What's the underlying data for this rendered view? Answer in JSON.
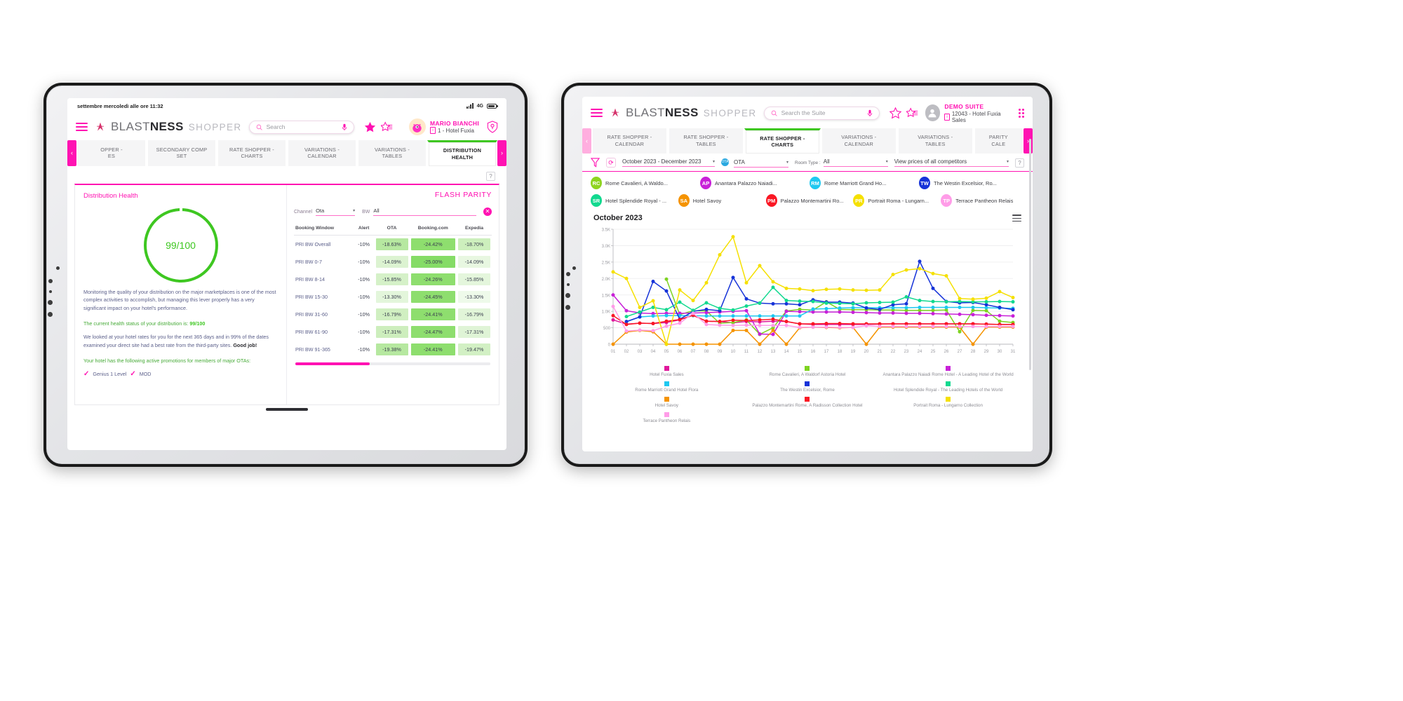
{
  "colors": {
    "pink": "#ff12b2",
    "green": "#3ec721",
    "text": "#3c3c42"
  },
  "left_tablet": {
    "statusbar": {
      "date": "settembre mercoledì alle ore 11:32",
      "network": "4G"
    },
    "appbar": {
      "menu_icon": "hamburger-icon",
      "brand_a": "BLAST",
      "brand_b": "NESS",
      "sub_brand": "SHOPPER",
      "search_placeholder": "Search",
      "mic_icon": "microphone-icon",
      "star_filled_icon": "star-filled-icon",
      "star_list_icon": "star-list-icon",
      "user_name": "MARIO BIANCHI",
      "user_hotel": "1 - Hotel Fuxia",
      "shield_icon": "shield-key-icon"
    },
    "tabs": [
      {
        "label": "OPPER -\nES",
        "active": false
      },
      {
        "label": "SECONDARY COMP\nSET",
        "active": false
      },
      {
        "label": "RATE SHOPPER -\nCHARTS",
        "active": false
      },
      {
        "label": "VARIATIONS -\nCALENDAR",
        "active": false
      },
      {
        "label": "VARIATIONS -\nTABLES",
        "active": false
      },
      {
        "label": "DISTRIBUTION\nHEALTH",
        "active": true
      }
    ],
    "help_label": "?",
    "distribution": {
      "title": "Distribution Health",
      "score": "99/100",
      "paragraph_1": "Monitoring the quality of your distribution on the major marketplaces is one of the most complex activities to accomplish, but managing this lever properly has a very significant impact on your hotel's performance.",
      "status_prefix": "The current health status of your distribution is:",
      "status_value": "99/100",
      "paragraph_2_a": "We looked at your hotel rates for you for the next 365 days and in 99% of the dates examined your direct site had a best rate from the third-party sites.",
      "paragraph_2_b": "Good job!",
      "promotions_intro": "Your hotel has the following active promotions for members of major OTAs:",
      "promotions": [
        "Genius 1 Level",
        "MOD"
      ]
    },
    "flash_parity": {
      "title": "FLASH PARITY",
      "channel_label": "Channel",
      "channel_value": "Ota",
      "bw_label": "BW",
      "bw_value": "All",
      "clear_icon": "clear-circle-icon",
      "columns": [
        "Booking Window",
        "Alert",
        "OTA",
        "Booking.com",
        "Expedia"
      ],
      "rows": [
        {
          "window": "PRI BW Overall",
          "alert": "-10%",
          "ota": "-18.63%",
          "booking": "-24.42%",
          "expedia": "-18.70%",
          "ota_bg": "#b6e8a0",
          "booking_bg": "#8ede6e",
          "expedia_bg": "#cdefbd"
        },
        {
          "window": "PRI BW 0-7",
          "alert": "-10%",
          "ota": "-14.09%",
          "booking": "-25.00%",
          "expedia": "-14.09%",
          "ota_bg": "#dcf3d1",
          "booking_bg": "#85dc66",
          "expedia_bg": "#e8f7e1"
        },
        {
          "window": "PRI BW 8-14",
          "alert": "-10%",
          "ota": "-15.85%",
          "booking": "-24.26%",
          "expedia": "-15.85%",
          "ota_bg": "#d5f1c8",
          "booking_bg": "#8ede6e",
          "expedia_bg": "#e4f6dc"
        },
        {
          "window": "PRI BW 15-30",
          "alert": "-10%",
          "ota": "-13.30%",
          "booking": "-24.45%",
          "expedia": "-13.30%",
          "ota_bg": "#e3f6db",
          "booking_bg": "#8ede6e",
          "expedia_bg": "#eefaea"
        },
        {
          "window": "PRI BW 31-60",
          "alert": "-10%",
          "ota": "-16.79%",
          "booking": "-24.41%",
          "expedia": "-16.79%",
          "ota_bg": "#d0efc1",
          "booking_bg": "#8ede6e",
          "expedia_bg": "#e1f5d8"
        },
        {
          "window": "PRI BW 61-90",
          "alert": "-10%",
          "ota": "-17.31%",
          "booking": "-24.47%",
          "expedia": "-17.31%",
          "ota_bg": "#cdeebd",
          "booking_bg": "#8ede6e",
          "expedia_bg": "#dff4d6"
        },
        {
          "window": "PRI BW 91-365",
          "alert": "-10%",
          "ota": "-19.38%",
          "booking": "-24.41%",
          "expedia": "-19.47%",
          "ota_bg": "#b6e8a0",
          "booking_bg": "#8ede6e",
          "expedia_bg": "#d2f0c4"
        }
      ]
    }
  },
  "right_tablet": {
    "appbar": {
      "menu_icon": "hamburger-icon",
      "brand_a": "BLAST",
      "brand_b": "NESS",
      "sub_brand": "SHOPPER",
      "search_placeholder": "Search the Suite",
      "mic_icon": "microphone-icon",
      "star_outline_icon": "star-outline-icon",
      "star_list_icon": "star-list-icon",
      "user_name": "DEMO SUITE",
      "user_hotel": "12043 - Hotel Fuxia Sales",
      "grid_icon": "grid-apps-icon"
    },
    "tabs": [
      {
        "label": "RATE SHOPPER -\nCALENDAR",
        "active": false
      },
      {
        "label": "RATE SHOPPER -\nTABLES",
        "active": false
      },
      {
        "label": "RATE SHOPPER -\nCHARTS",
        "active": true
      },
      {
        "label": "VARIATIONS -\nCALENDAR",
        "active": false
      },
      {
        "label": "VARIATIONS -\nTABLES",
        "active": false
      },
      {
        "label": "PARITY\nCALE",
        "active": false
      }
    ],
    "filters": {
      "filter_icon": "funnel-icon",
      "refresh_icon": "refresh-icon",
      "date_range": "October 2023 - December 2023",
      "channel_icon": "ota-badge-icon",
      "channel": "OTA",
      "room_type_label": "Room Type :",
      "room_type": "All",
      "competitor_view": "View prices of all competitors",
      "help_label": "?"
    },
    "competitor_chips": [
      {
        "initials": "RC",
        "name": "Rome Cavalieri, A Waldo...",
        "color": "#8ed420"
      },
      {
        "initials": "AP",
        "name": "Anantara Palazzo Naiadi...",
        "color": "#c821d8"
      },
      {
        "initials": "RM",
        "name": "Rome Marriott Grand Ho...",
        "color": "#1ec8f0"
      },
      {
        "initials": "TW",
        "name": "The Westin Excelsior, Ro...",
        "color": "#1633d8"
      },
      {
        "initials": "SR",
        "name": "Hotel Splendide Royal - ...",
        "color": "#12d98f"
      },
      {
        "initials": "SA",
        "name": "Hotel Savoy",
        "color": "#f59300"
      },
      {
        "initials": "PM",
        "name": "Palazzo Montemartini Ro...",
        "color": "#fa1724"
      },
      {
        "initials": "PR",
        "name": "Portrait Roma - Lungarn...",
        "color": "#f5e000"
      },
      {
        "initials": "TP",
        "name": "Terrace Pantheon Relais",
        "color": "#ff9ce8"
      }
    ],
    "chart_menu_icon": "chart-menu-icon"
  },
  "chart_data": {
    "type": "line",
    "title": "October 2023",
    "xlabel": "",
    "ylabel": "",
    "ylim": [
      0,
      3500
    ],
    "yticks": [
      0,
      500,
      1000,
      1500,
      2000,
      2500,
      3000,
      3500
    ],
    "ytick_labels": [
      "0",
      "500",
      "1.0K",
      "1.5K",
      "2.0K",
      "2.5K",
      "3.0K",
      "3.5K"
    ],
    "grid": true,
    "legend_position": "bottom",
    "categories": [
      "01",
      "02",
      "03",
      "04",
      "05",
      "06",
      "07",
      "08",
      "09",
      "10",
      "11",
      "12",
      "13",
      "14",
      "15",
      "16",
      "17",
      "18",
      "19",
      "20",
      "21",
      "22",
      "23",
      "24",
      "25",
      "26",
      "27",
      "28",
      "29",
      "30",
      "31"
    ],
    "series": [
      {
        "name": "Hotel Fuxia Sales",
        "color": "#e0189c",
        "values": [
          740,
          610,
          640,
          630,
          660,
          740,
          880,
          700,
          690,
          650,
          690,
          680,
          700,
          690,
          620,
          600,
          600,
          600,
          600,
          600,
          610,
          620,
          620,
          620,
          620,
          620,
          620,
          620,
          610,
          600,
          600
        ]
      },
      {
        "name": "Rome Cavalieri, A Waldorf Astoria Hotel",
        "color": "#7ed321",
        "values": [
          null,
          null,
          null,
          null,
          1980,
          900,
          1020,
          1010,
          640,
          660,
          740,
          300,
          500,
          1010,
          1060,
          1040,
          1290,
          1060,
          1050,
          1050,
          1040,
          1040,
          1030,
          1030,
          1030,
          1040,
          380,
          1030,
          1020,
          700,
          660
        ]
      },
      {
        "name": "Anantara Palazzo Naiadi Rome Hotel - A Leading Hotel of the World",
        "color": "#c821d8",
        "values": [
          1500,
          1020,
          950,
          930,
          940,
          940,
          950,
          960,
          980,
          1000,
          1020,
          310,
          300,
          1000,
          990,
          980,
          980,
          980,
          970,
          960,
          950,
          950,
          940,
          940,
          930,
          920,
          910,
          900,
          880,
          870,
          860
        ]
      },
      {
        "name": "Rome Marriott Grand Hotel Flora",
        "color": "#1ec8f0",
        "values": [
          null,
          680,
          830,
          860,
          870,
          870,
          870,
          860,
          860,
          860,
          860,
          860,
          860,
          860,
          860,
          1070,
          1080,
          1100,
          1110,
          1110,
          1110,
          1110,
          1110,
          1120,
          1120,
          1120,
          1120,
          1120,
          1110,
          1100,
          1090
        ]
      },
      {
        "name": "The Westin Excelsior, Rome",
        "color": "#1633d8",
        "values": [
          null,
          690,
          830,
          1910,
          1620,
          760,
          1000,
          1060,
          1020,
          2030,
          1380,
          1250,
          1230,
          1230,
          1200,
          1350,
          1280,
          1280,
          1250,
          1100,
          1060,
          1200,
          1230,
          2520,
          1700,
          1300,
          1260,
          1270,
          1200,
          1120,
          1050
        ]
      },
      {
        "name": "Hotel Splendide Royal - The Leading Hotels of the World",
        "color": "#12d98f",
        "values": [
          null,
          840,
          980,
          1120,
          1050,
          1280,
          1030,
          1260,
          1090,
          1040,
          1160,
          1250,
          1730,
          1330,
          1310,
          1300,
          1250,
          1240,
          1230,
          1260,
          1270,
          1280,
          1440,
          1330,
          1300,
          1290,
          1300,
          1290,
          1290,
          1300,
          1290
        ]
      },
      {
        "name": "Hotel Savoy",
        "color": "#f59300",
        "values": [
          0,
          370,
          420,
          380,
          0,
          0,
          0,
          0,
          0,
          420,
          420,
          0,
          420,
          0,
          500,
          520,
          510,
          500,
          510,
          0,
          520,
          520,
          520,
          520,
          520,
          520,
          520,
          0,
          520,
          520,
          520
        ]
      },
      {
        "name": "Palazzo Montemartini Rome, A Radisson Collection Hotel",
        "color": "#fa1724",
        "values": [
          870,
          600,
          640,
          630,
          700,
          750,
          880,
          700,
          690,
          730,
          720,
          740,
          760,
          690,
          620,
          620,
          630,
          630,
          620,
          620,
          620,
          620,
          620,
          620,
          620,
          620,
          620,
          620,
          610,
          600,
          600
        ]
      },
      {
        "name": "Portrait Roma - Lungarno Collection",
        "color": "#f5e000",
        "values": [
          2200,
          2000,
          1120,
          1320,
          0,
          1650,
          1330,
          1870,
          2720,
          3270,
          1870,
          2390,
          1900,
          1700,
          1680,
          1630,
          1670,
          1680,
          1650,
          1640,
          1650,
          2120,
          2260,
          2300,
          2150,
          2080,
          1390,
          1370,
          1400,
          1600,
          1420
        ]
      },
      {
        "name": "Terrace Pantheon Relais",
        "color": "#ff9ce8",
        "values": [
          1150,
          400,
          430,
          410,
          550,
          640,
          940,
          600,
          580,
          570,
          580,
          570,
          570,
          570,
          510,
          520,
          520,
          510,
          510,
          560,
          540,
          540,
          540,
          540,
          540,
          540,
          540,
          540,
          540,
          540,
          540
        ]
      }
    ]
  }
}
